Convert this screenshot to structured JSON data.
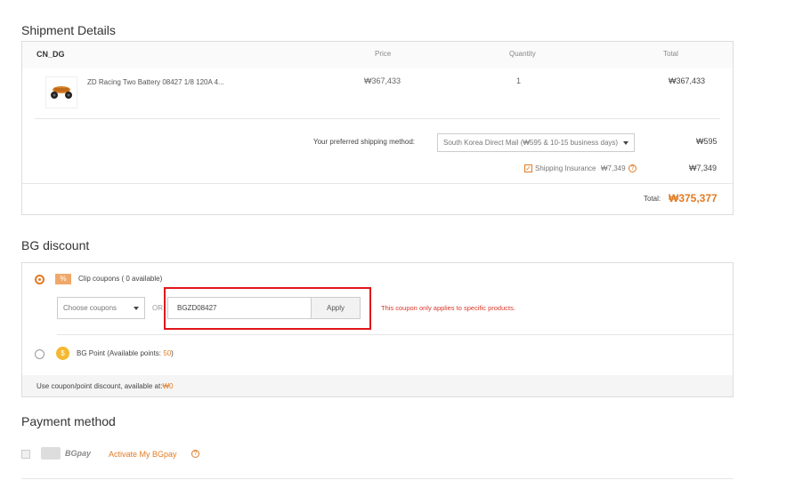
{
  "shipment": {
    "title": "Shipment Details",
    "warehouse": "CN_DG",
    "col_price": "Price",
    "col_quantity": "Quantity",
    "col_total": "Total",
    "item": {
      "name": "ZD Racing Two Battery 08427 1/8 120A 4...",
      "price": "₩367,433",
      "quantity": "1",
      "total": "₩367,433"
    },
    "shipping_label": "Your preferred shipping method:",
    "shipping_method": "South Korea Direct Mail (₩595 & 10-15 business days)",
    "shipping_cost": "₩595",
    "insurance_label": "Shipping Insurance",
    "insurance_price": "₩7,349",
    "insurance_cost": "₩7,349",
    "insurance_checked": "✓",
    "total_label": "Total:",
    "total_value": "₩375,377"
  },
  "discount": {
    "title": "BG discount",
    "coupon_tag": "%",
    "clip_coupons": "Clip coupons ( 0 available)",
    "choose_coupons": "Choose coupons",
    "or": "OR",
    "coupon_code": "BGZD08427",
    "apply": "Apply",
    "error": "This coupon only applies to specific products.",
    "bg_point_icon": "$",
    "bg_point_label": "BG Point (Available points: ",
    "bg_point_value": "50",
    "bg_point_close": ")",
    "footer_label": "Use coupon/point discount, available at:",
    "footer_value": "₩0"
  },
  "payment": {
    "title": "Payment method",
    "card_text": "BGpay",
    "activate": "Activate My BGpay",
    "help": "?"
  },
  "colors": {
    "accent": "#e07b24",
    "error": "#d9372a",
    "highlight_box": "#e0161b"
  }
}
